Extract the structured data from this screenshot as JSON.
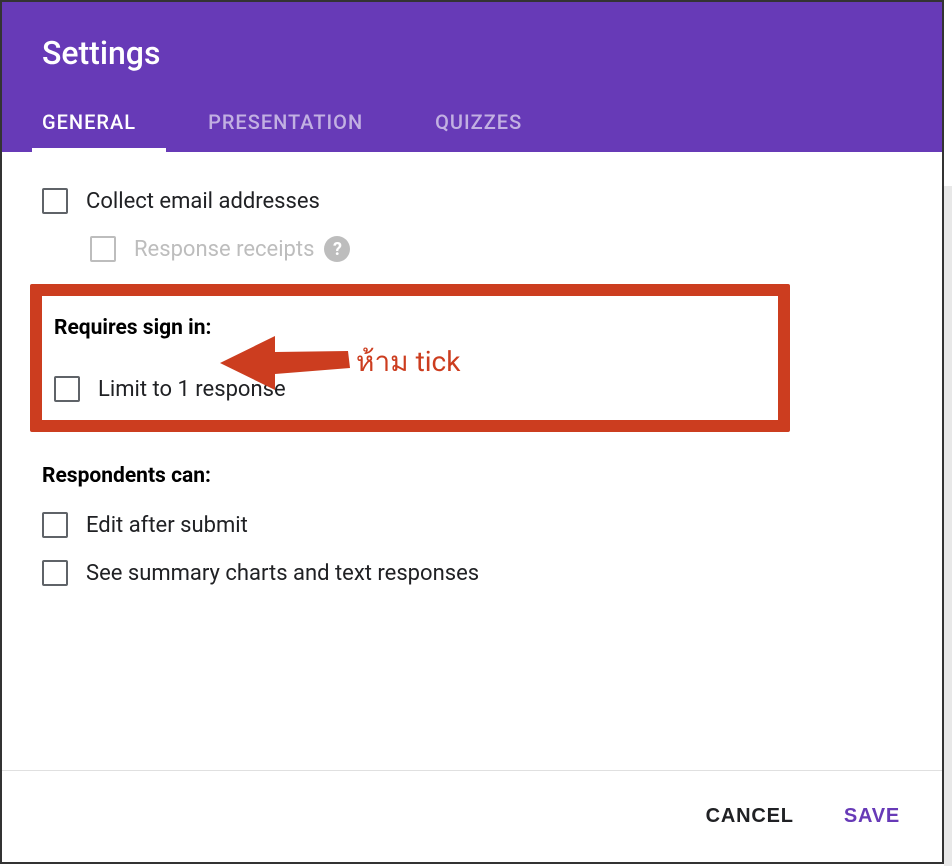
{
  "dialog": {
    "title": "Settings"
  },
  "tabs": {
    "general": "GENERAL",
    "presentation": "PRESENTATION",
    "quizzes": "QUIZZES"
  },
  "options": {
    "collect_email": "Collect email addresses",
    "response_receipts": "Response receipts",
    "requires_signin_label": "Requires sign in:",
    "limit_response": "Limit to 1 response",
    "respondents_label": "Respondents can:",
    "edit_after_submit": "Edit after submit",
    "see_summary": "See summary charts and text responses"
  },
  "annotation": {
    "text": "ห้าม tick"
  },
  "footer": {
    "cancel": "CANCEL",
    "save": "SAVE"
  }
}
